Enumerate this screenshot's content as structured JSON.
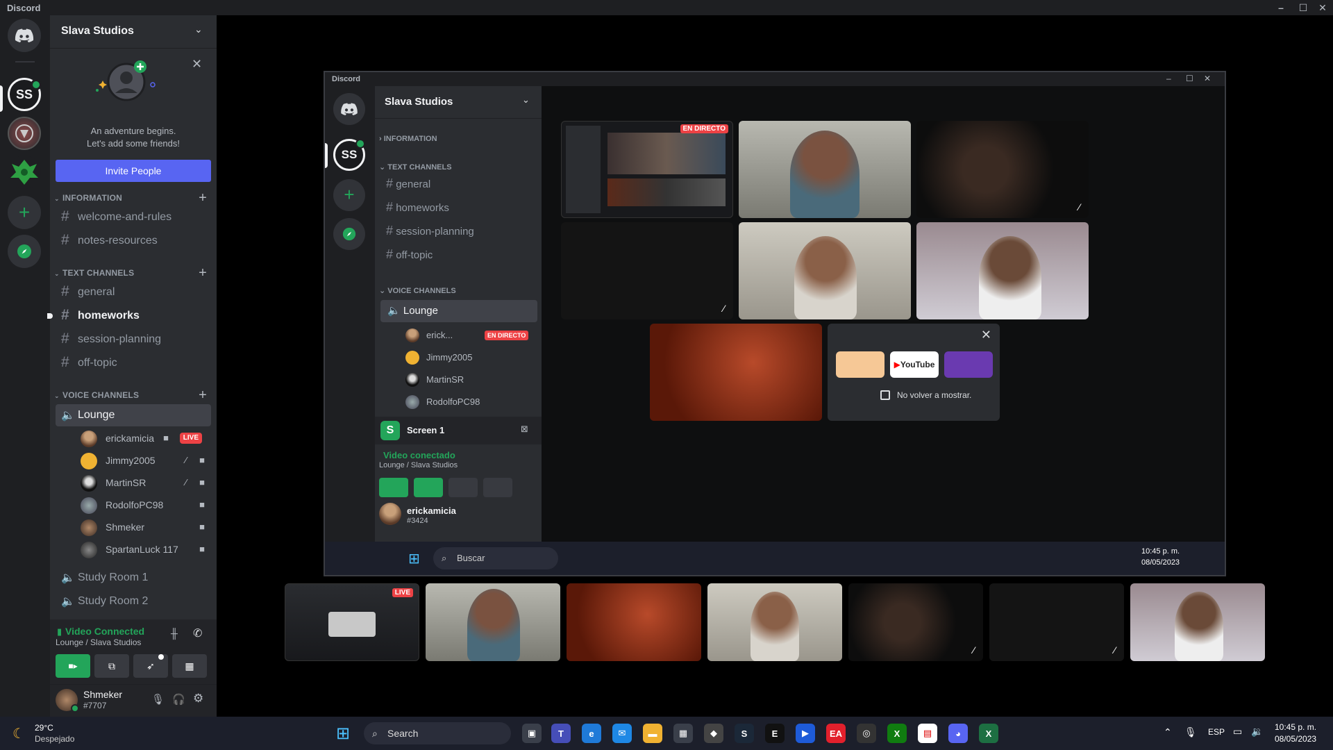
{
  "window": {
    "title": "Discord"
  },
  "server": {
    "name": "Slava Studios",
    "icon_initials": "SS"
  },
  "onboarding": {
    "line1": "An adventure begins.",
    "line2": "Let's add some friends!",
    "invite_label": "Invite People"
  },
  "categories": {
    "information": "INFORMATION",
    "text": "TEXT CHANNELS",
    "voice": "VOICE CHANNELS"
  },
  "info_channels": [
    "welcome-and-rules",
    "notes-resources"
  ],
  "text_channels": [
    "general",
    "homeworks",
    "session-planning",
    "off-topic"
  ],
  "voice": {
    "lounge": "Lounge",
    "users": [
      {
        "name": "erickamicia",
        "badge": "LIVE"
      },
      {
        "name": "Jimmy2005"
      },
      {
        "name": "MartinSR"
      },
      {
        "name": "RodolfoPC98"
      },
      {
        "name": "Shmeker"
      },
      {
        "name": "SpartanLuck 117"
      }
    ],
    "other_rooms": [
      "Study Room 1",
      "Study Room 2"
    ]
  },
  "voice_panel": {
    "status": "Video Connected",
    "location": "Lounge / Slava Studios"
  },
  "user_panel": {
    "name": "Shmeker",
    "tag": "#7707"
  },
  "nested": {
    "title": "Discord",
    "server_name": "Slava Studios",
    "categories": {
      "information": "INFORMATION",
      "text": "TEXT CHANNELS",
      "voice": "VOICE CHANNELS"
    },
    "text_channels": [
      "general",
      "homeworks",
      "session-planning",
      "off-topic"
    ],
    "lounge": "Lounge",
    "users": [
      {
        "name": "erick...",
        "badge": "EN DIRECTO"
      },
      {
        "name": "Jimmy2005"
      },
      {
        "name": "MartinSR"
      },
      {
        "name": "RodolfoPC98"
      }
    ],
    "screen_label": "Screen 1",
    "voice_status": "Video conectado",
    "voice_location": "Lounge / Slava Studios",
    "user_name": "erickamicia",
    "user_tag": "#3424",
    "live_badge": "EN DIRECTO",
    "activity": {
      "youtube": "YouTube",
      "checkbox_label": "No volver a mostrar."
    },
    "taskbar_search": "Buscar",
    "time": "10:45 p. m.",
    "date": "08/05/2023"
  },
  "strip": {
    "live_badge": "LIVE"
  },
  "taskbar": {
    "weather_temp": "29°C",
    "weather_desc": "Despejado",
    "search": "Search",
    "lang": "ESP",
    "time": "10:45 p. m.",
    "date": "08/05/2023"
  },
  "colors": {
    "blurple": "#5865f2",
    "green": "#23a55a",
    "red": "#ed4245",
    "sidebar": "#2b2d31",
    "rail": "#1e1f22"
  }
}
